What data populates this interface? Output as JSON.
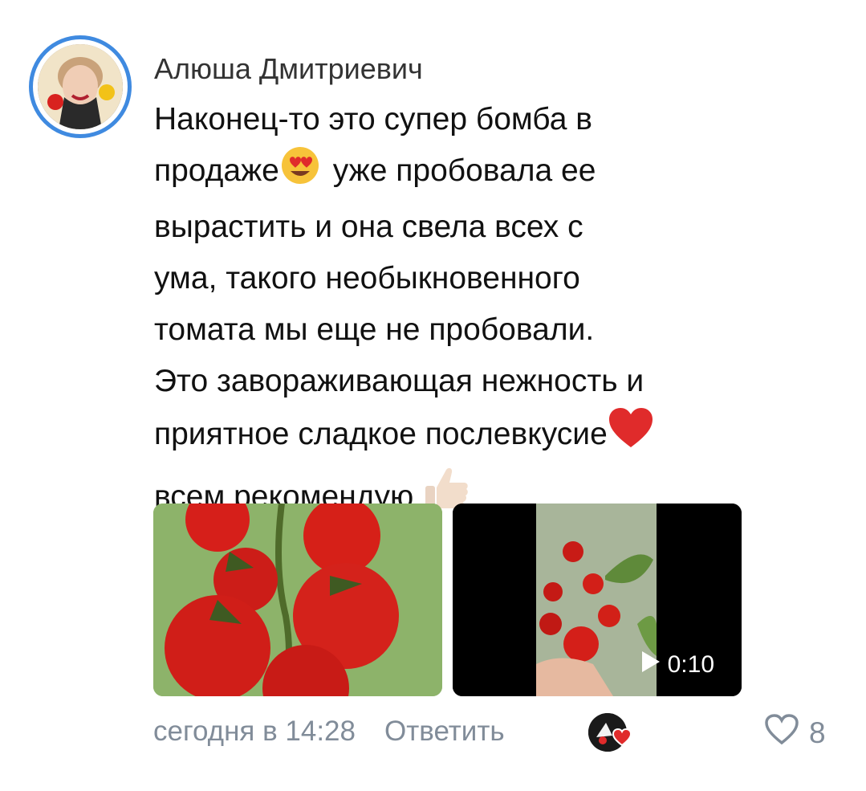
{
  "comment": {
    "author": "Алюша Дмитриевич",
    "lines": [
      "Наконец-то это супер бомба в",
      "продаже",
      "уже пробовала ее",
      "вырастить и она свела всех с",
      "ума, такого необыкновенного",
      "томата мы еще не пробовали.",
      "Это завораживающая нежность и",
      "приятное сладкое послевкусие",
      "всем рекомендую"
    ],
    "emojis": [
      "heart-eyes-emoji",
      "red-heart-emoji",
      "thumbs-up-emoji"
    ]
  },
  "attachments": {
    "video_duration": "0:10"
  },
  "footer": {
    "timestamp": "сегодня в 14:28",
    "reply_label": "Ответить",
    "like_count": "8"
  },
  "colors": {
    "accent": "#3f8ae0",
    "secondary_text": "#818c99",
    "heart": "#e02b2b"
  }
}
